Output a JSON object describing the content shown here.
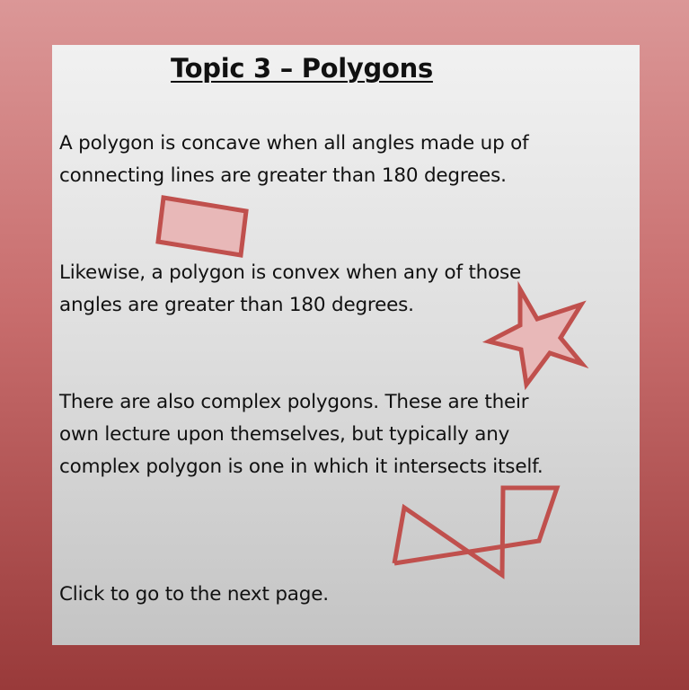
{
  "slide": {
    "title": "Topic 3 – Polygons",
    "paragraphs": [
      {
        "lines": [
          "A polygon is concave when all angles made up of",
          "connecting lines are greater than 180 degrees."
        ]
      },
      {
        "lines": [
          "Likewise, a polygon is convex when any of those",
          "angles are greater than 180 degrees."
        ]
      },
      {
        "lines": [
          "There are also complex polygons. These are their",
          "own lecture upon themselves, but typically any",
          "complex polygon is one in which it intersects itself."
        ]
      },
      {
        "lines": [
          "Click to go to the next page."
        ]
      }
    ]
  },
  "colors": {
    "shape_stroke": "#c0504d",
    "shape_fill": "#e8b8b8",
    "background_top": "#db9797",
    "background_bottom": "#993a3a"
  }
}
